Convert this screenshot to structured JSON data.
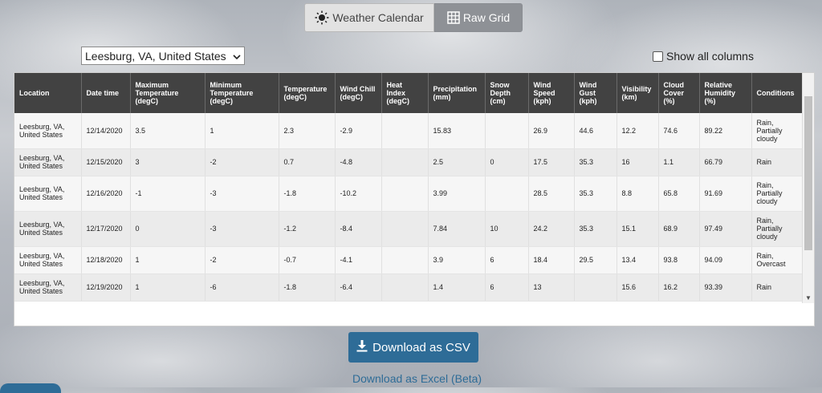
{
  "tabs": [
    {
      "label": "Weather Calendar",
      "icon": "sun-icon"
    },
    {
      "label": "Raw Grid",
      "icon": "grid-icon",
      "active": true
    }
  ],
  "location_select": {
    "value": "Leesburg, VA, United States"
  },
  "show_all_columns": {
    "label": "Show all columns",
    "checked": false
  },
  "table": {
    "headers": [
      "Location",
      "Date time",
      "Maximum Temperature (degC)",
      "Minimum Temperature (degC)",
      "Temperature (degC)",
      "Wind Chill (degC)",
      "Heat Index (degC)",
      "Precipitation (mm)",
      "Snow Depth (cm)",
      "Wind Speed (kph)",
      "Wind Gust (kph)",
      "Visibility (km)",
      "Cloud Cover (%)",
      "Relative Humidity (%)",
      "Conditions"
    ],
    "rows": [
      [
        "Leesburg, VA, United States",
        "12/14/2020",
        "3.5",
        "1",
        "2.3",
        "-2.9",
        "",
        "15.83",
        "",
        "26.9",
        "44.6",
        "12.2",
        "74.6",
        "89.22",
        "Rain, Partially cloudy"
      ],
      [
        "Leesburg, VA, United States",
        "12/15/2020",
        "3",
        "-2",
        "0.7",
        "-4.8",
        "",
        "2.5",
        "0",
        "17.5",
        "35.3",
        "16",
        "1.1",
        "66.79",
        "Rain"
      ],
      [
        "Leesburg, VA, United States",
        "12/16/2020",
        "-1",
        "-3",
        "-1.8",
        "-10.2",
        "",
        "3.99",
        "",
        "28.5",
        "35.3",
        "8.8",
        "65.8",
        "91.69",
        "Rain, Partially cloudy"
      ],
      [
        "Leesburg, VA, United States",
        "12/17/2020",
        "0",
        "-3",
        "-1.2",
        "-8.4",
        "",
        "7.84",
        "10",
        "24.2",
        "35.3",
        "15.1",
        "68.9",
        "97.49",
        "Rain, Partially cloudy"
      ],
      [
        "Leesburg, VA, United States",
        "12/18/2020",
        "1",
        "-2",
        "-0.7",
        "-4.1",
        "",
        "3.9",
        "6",
        "18.4",
        "29.5",
        "13.4",
        "93.8",
        "94.09",
        "Rain, Overcast"
      ],
      [
        "Leesburg, VA, United States",
        "12/19/2020",
        "1",
        "-6",
        "-1.8",
        "-6.4",
        "",
        "1.4",
        "6",
        "13",
        "",
        "15.6",
        "16.2",
        "93.39",
        "Rain"
      ]
    ]
  },
  "download_csv": {
    "label": "Download as CSV",
    "icon": "download-icon"
  },
  "download_excel": {
    "label": "Download as Excel (Beta)"
  },
  "colors": {
    "accent": "#2e6c97",
    "header_bg": "#424242",
    "active_tab": "#8e9196"
  }
}
